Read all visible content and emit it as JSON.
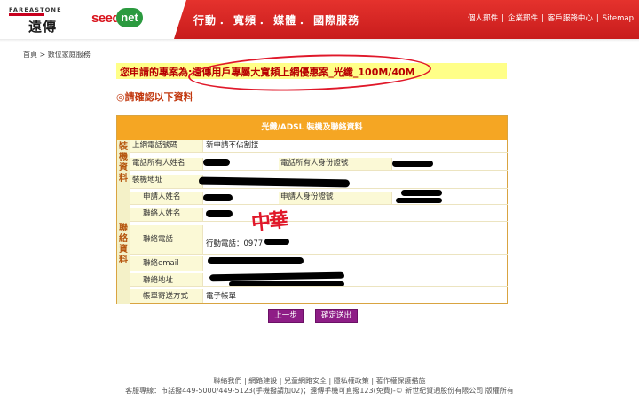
{
  "header": {
    "fet_logo_en": "FAREASTONE",
    "fet_logo_cn": "遠傳",
    "seed_logo_seed": "seed",
    "seed_logo_net": "net",
    "main_nav": [
      "行動",
      "寬頻",
      "媒體",
      "國際服務"
    ],
    "nav_separator": "．",
    "util_nav": [
      "個人郵件",
      "企業郵件",
      "客戶服務中心",
      "Sitemap"
    ],
    "util_separator": "|",
    "brand_red": "#d9151e",
    "brand_green": "#2b9a3f"
  },
  "breadcrumb": "首頁 > 數位家庭服務",
  "plan": {
    "text": "您申請的專案為:遠傳用戶專屬大寬頻上網優惠案_光纖_100M/40M"
  },
  "confirm_title": "◎請確認以下資料",
  "form": {
    "header": "光纖/ADSL 裝機及聯絡資料",
    "section_install": "裝機資料",
    "section_contact": "聯絡資料",
    "rows": {
      "phone_label": "上網電話號碼",
      "phone_value": "新申請不佔割接",
      "owner_name_label": "電話所有人姓名",
      "owner_id_label": "電話所有人身份證號",
      "install_address_label": "裝機地址",
      "applicant_name_label": "申請人姓名",
      "applicant_id_label": "申請人身份證號",
      "contact_name_label": "聯絡人姓名",
      "contact_phone_label": "聯絡電話",
      "contact_phone_value": "行動電話：0977",
      "contact_email_label": "聯絡email",
      "contact_address_label": "聯絡地址",
      "billing_label": "帳單寄送方式",
      "billing_value": "電子帳單"
    }
  },
  "handwritten_mark": "中華",
  "buttons": {
    "prev": "上一步",
    "submit": "確定送出"
  },
  "footer": {
    "links": "聯絡我們 | 網路建設 | 兒童網路安全 | 隱私權政策 | 著作權保護措施",
    "copyright": "客服專線：市話撥449-5000/449-5123(手機撥請加02)；遠傳手機可直撥123(免費)-© 新世紀資通股份有限公司 版權所有"
  }
}
